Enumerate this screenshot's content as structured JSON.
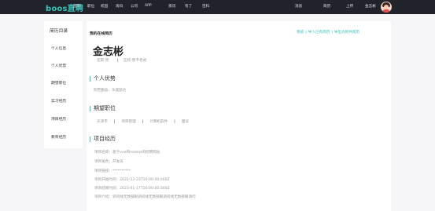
{
  "header": {
    "logo": "boos直聘",
    "nav": [
      "首页",
      "职位",
      "校园",
      "海归",
      "公司",
      "APP",
      "资讯",
      "有了",
      "百科"
    ],
    "right_nav": [
      "消息",
      "简历",
      "上传"
    ],
    "user_name": "金志彬"
  },
  "sidebar": {
    "title": "简历目录",
    "items": [
      "个人信息",
      "个人优势",
      "期望职位",
      "实习经历",
      "项目经历",
      "教育经历"
    ]
  },
  "main": {
    "title": "我的在线简历",
    "actions": [
      "预览",
      "导入已有简历",
      "导出为附件简历"
    ],
    "name": "金志彬",
    "status": [
      "在职-完",
      "在校-暂不考虑"
    ],
    "sections": {
      "advantage_title": "个人优势",
      "advantage_text": "刻苦勤奋、乐观豁达",
      "expect_title": "期望职位",
      "expect_items": [
        "天津市",
        "项目管理",
        "计算机软件",
        "面议"
      ],
      "project_title": "项目经历",
      "project_lines": [
        "项目名称：基于vue和nodejs的招聘网站",
        "项目角色：开发员",
        "项目链接：**********",
        "项目开始时间：2022-12-23T16:00:00.000Z",
        "项目结束时间：2023-01-17T16:00:00.000Z",
        "项目介绍：调问线无致部眼调问线无致部眼调问线无致部眼调问"
      ]
    }
  }
}
